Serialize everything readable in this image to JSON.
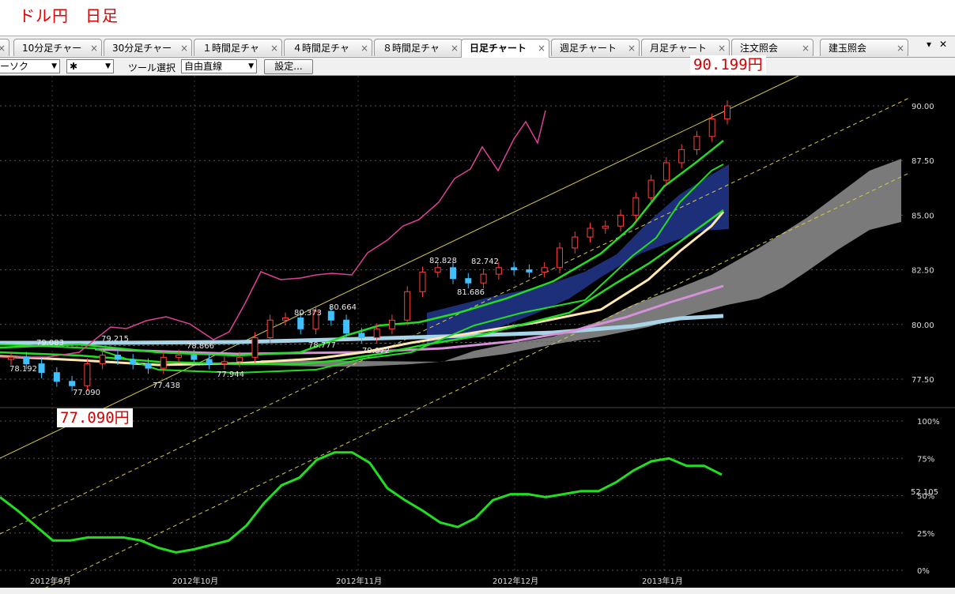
{
  "caption": "ドル円　日足",
  "tabs": [
    {
      "label": "10分足チャー"
    },
    {
      "label": "30分足チャー"
    },
    {
      "label": "１時間足チャ"
    },
    {
      "label": "４時間足チャ"
    },
    {
      "label": "８時間足チャ"
    },
    {
      "label": "日足チャート"
    },
    {
      "label": "週足チャート"
    },
    {
      "label": "月足チャート"
    },
    {
      "label": "注文照会"
    },
    {
      "label": "建玉照会"
    }
  ],
  "tab_close": "×",
  "tab_menu": "▾",
  "window_close": "✕",
  "toolbar": {
    "chart_type": "ーソク",
    "marker": "✱",
    "tool_label": "ツール選択",
    "tool_value": "自由直線",
    "settings_button": "設定..."
  },
  "callouts": {
    "high": "90.199円",
    "low": "77.090円"
  },
  "chart_data": [
    {
      "type": "candlestick",
      "title": "",
      "y_axis_labels": [
        "90.00",
        "87.50",
        "85.00",
        "82.50",
        "80.00",
        "77.50"
      ],
      "ylim": [
        77.5,
        90.0
      ],
      "x_axis_labels": [
        "2012年9月",
        "2012年10月",
        "2012年11月",
        "2012年12月",
        "2013年1月"
      ],
      "annotations": [
        "78.192",
        "79.083",
        "77.090",
        "79.215",
        "78.866",
        "77.438",
        "77.944",
        "80.373",
        "78.777",
        "80.664",
        "79.072",
        "82.828",
        "81.686",
        "82.742"
      ],
      "series": [
        {
          "values": [
            78.5,
            78.2,
            77.8,
            77.4,
            77.2,
            78.2,
            78.6,
            78.4,
            78.2,
            78.0,
            78.5,
            78.6,
            78.4,
            78.2,
            78.3,
            78.5,
            79.4,
            80.2,
            80.3,
            79.8,
            80.6,
            80.2,
            79.6,
            79.4,
            79.8,
            80.2,
            81.5,
            82.4,
            82.6,
            82.1,
            81.9,
            82.3,
            82.6,
            82.5,
            82.4,
            82.6,
            83.5,
            84.0,
            84.4,
            84.5,
            85.0,
            85.8,
            86.6,
            87.4,
            88.0,
            88.6,
            89.4,
            90.0
          ]
        }
      ],
      "grid": true
    },
    {
      "type": "line",
      "title": "",
      "y_axis_labels": [
        "100%",
        "75%",
        "50%",
        "25%",
        "0%"
      ],
      "ylim": [
        0,
        100
      ],
      "right_label": "52.105",
      "series": [
        {
          "values": [
            49,
            40,
            30,
            20,
            20,
            22,
            22,
            22,
            20,
            15,
            12,
            14,
            17,
            20,
            30,
            45,
            57,
            62,
            74,
            79,
            79,
            72,
            55,
            47,
            40,
            32,
            29,
            35,
            47,
            51,
            51,
            49,
            51,
            53,
            53,
            59,
            67,
            73,
            75,
            70,
            70,
            64
          ]
        }
      ],
      "grid": true
    }
  ]
}
